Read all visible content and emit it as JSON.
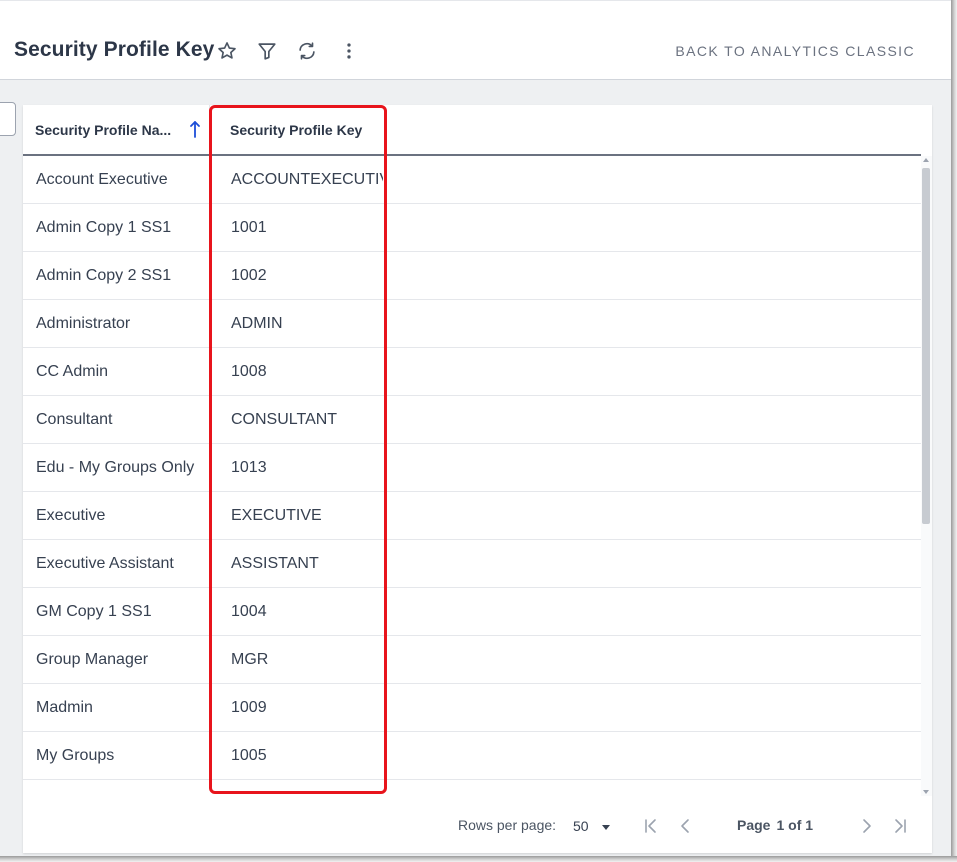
{
  "header": {
    "title": "Security Profile Key",
    "back_link": "BACK TO ANALYTICS CLASSIC",
    "icons": [
      "star-icon",
      "filter-icon",
      "refresh-icon",
      "more-vertical-icon"
    ]
  },
  "table": {
    "columns": [
      "Security Profile Na...",
      "Security Profile Key"
    ],
    "sort": "ascending",
    "rows": [
      {
        "name": "Account Executive",
        "key": "ACCOUNTEXECUTIVE"
      },
      {
        "name": "Admin Copy 1 SS1",
        "key": "1001"
      },
      {
        "name": "Admin Copy 2 SS1",
        "key": "1002"
      },
      {
        "name": "Administrator",
        "key": "ADMIN"
      },
      {
        "name": "CC Admin",
        "key": "1008"
      },
      {
        "name": "Consultant",
        "key": "CONSULTANT"
      },
      {
        "name": "Edu - My Groups Only",
        "key": "1013"
      },
      {
        "name": "Executive",
        "key": "EXECUTIVE"
      },
      {
        "name": "Executive Assistant",
        "key": "ASSISTANT"
      },
      {
        "name": "GM Copy 1 SS1",
        "key": "1004"
      },
      {
        "name": "Group Manager",
        "key": "MGR"
      },
      {
        "name": "Madmin",
        "key": "1009"
      },
      {
        "name": "My Groups",
        "key": "1005"
      }
    ]
  },
  "footer": {
    "rows_per_page_label": "Rows per page:",
    "rows_per_page_value": "50",
    "page_word": "Page",
    "page_of": "1 of 1"
  },
  "colors": {
    "highlight": "#e8141c",
    "sort_arrow": "#1d4ed8",
    "header_text": "#2d3748"
  }
}
